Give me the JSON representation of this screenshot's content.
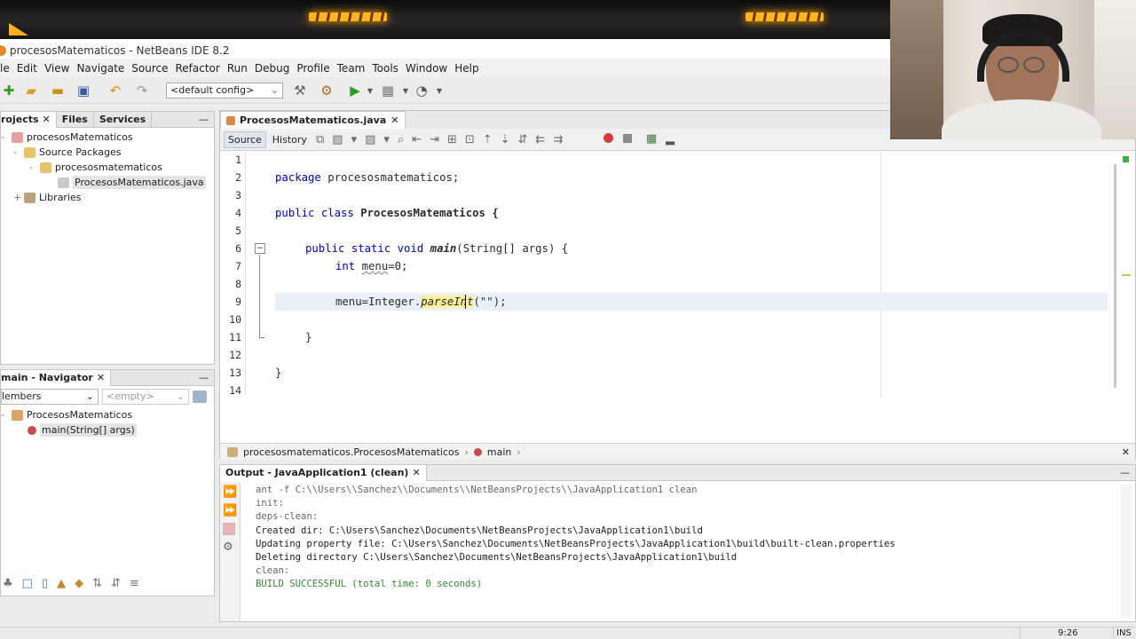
{
  "window": {
    "title": "procesosMatematicos - NetBeans IDE 8.2"
  },
  "menu": [
    "le",
    "Edit",
    "View",
    "Navigate",
    "Source",
    "Refactor",
    "Run",
    "Debug",
    "Profile",
    "Team",
    "Tools",
    "Window",
    "Help"
  ],
  "toolbar": {
    "config": "<default config>"
  },
  "projects": {
    "tabs": [
      "rojects",
      "Files",
      "Services"
    ],
    "tree": [
      "procesosMatematicos",
      "Source Packages",
      "procesosmatematicos",
      "ProcesosMatematicos.java",
      "Libraries"
    ]
  },
  "navigator": {
    "title": "main - Navigator",
    "filter": "lembers",
    "empty": "<empty>",
    "tree": [
      "ProcesosMatematicos",
      "main(String[] args)"
    ]
  },
  "editor": {
    "tab": "ProcesosMatematicos.java",
    "source_label": "Source",
    "history_label": "History",
    "line_numbers": [
      "1",
      "2",
      "3",
      "4",
      "5",
      "6",
      "7",
      "8",
      "9",
      "10",
      "11",
      "12",
      "13",
      "14"
    ],
    "lines": {
      "l2_kw": "package",
      "l2_rest": " procesosmatematicos;",
      "l4_kw": "public class",
      "l4_rest": " ProcesosMatematicos {",
      "l6_kw": "public static void",
      "l6_name": "main",
      "l6_rest": "(String[] args) {",
      "l7_kw": "int",
      "l7_var": "menu",
      "l7_rest": "=0;",
      "l9_pre": "menu=Integer.",
      "l9_call": "parseInt",
      "l9_rest": "(\"\");",
      "l11": "}",
      "l13": "}"
    },
    "breadcrumb": [
      "procesosmatematicos.ProcesosMatematicos",
      "main"
    ]
  },
  "output": {
    "title": "Output - JavaApplication1 (clean)",
    "lines": [
      "ant -f C:\\\\Users\\\\Sanchez\\\\Documents\\\\NetBeansProjects\\\\JavaApplication1 clean",
      "init:",
      "deps-clean:",
      "Created dir: C:\\Users\\Sanchez\\Documents\\NetBeansProjects\\JavaApplication1\\build",
      "Updating property file: C:\\Users\\Sanchez\\Documents\\NetBeansProjects\\JavaApplication1\\build\\built-clean.properties",
      "Deleting directory C:\\Users\\Sanchez\\Documents\\NetBeansProjects\\JavaApplication1\\build",
      "clean:",
      "BUILD SUCCESSFUL (total time: 0 seconds)"
    ]
  },
  "status": {
    "position": "9:26",
    "mode": "INS"
  },
  "colors": {
    "accent": "#0b2b9f",
    "success": "#2e8b2e",
    "highlight": "#f3f7b4"
  }
}
